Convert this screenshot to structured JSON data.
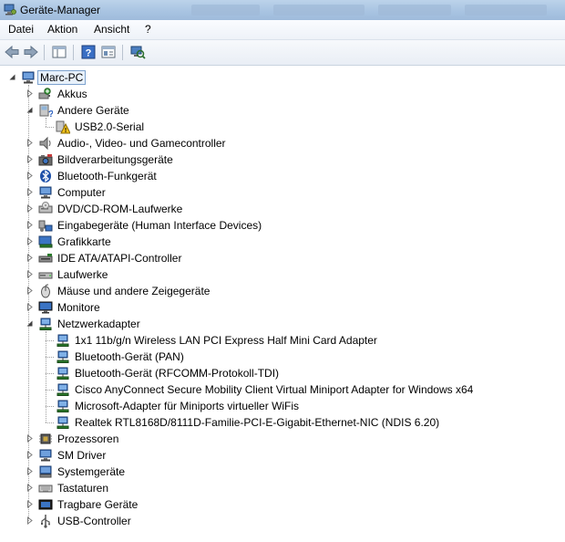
{
  "window": {
    "title": "Geräte-Manager"
  },
  "menu": {
    "items": [
      "Datei",
      "Aktion",
      "Ansicht",
      "?"
    ]
  },
  "toolbar": {
    "buttons": [
      "back-arrow-icon",
      "forward-arrow-icon",
      "console-tree-icon",
      "help-icon",
      "properties-icon",
      "scan-hardware-icon"
    ]
  },
  "tree": {
    "root": "Marc-PC",
    "categories": [
      {
        "label": "Akkus",
        "icon": "battery-icon",
        "expanded": false,
        "children": []
      },
      {
        "label": "Andere Geräte",
        "icon": "unknown-device-icon",
        "expanded": true,
        "children": [
          {
            "label": "USB2.0-Serial",
            "icon": "warning-device-icon"
          }
        ]
      },
      {
        "label": "Audio-, Video- und Gamecontroller",
        "icon": "speaker-icon",
        "expanded": false,
        "children": []
      },
      {
        "label": "Bildverarbeitungsgeräte",
        "icon": "camera-icon",
        "expanded": false,
        "children": []
      },
      {
        "label": "Bluetooth-Funkgerät",
        "icon": "bluetooth-icon",
        "expanded": false,
        "children": []
      },
      {
        "label": "Computer",
        "icon": "computer-icon",
        "expanded": false,
        "children": []
      },
      {
        "label": "DVD/CD-ROM-Laufwerke",
        "icon": "dvd-drive-icon",
        "expanded": false,
        "children": []
      },
      {
        "label": "Eingabegeräte (Human Interface Devices)",
        "icon": "hid-icon",
        "expanded": false,
        "children": []
      },
      {
        "label": "Grafikkarte",
        "icon": "display-adapter-icon",
        "expanded": false,
        "children": []
      },
      {
        "label": "IDE ATA/ATAPI-Controller",
        "icon": "ide-controller-icon",
        "expanded": false,
        "children": []
      },
      {
        "label": "Laufwerke",
        "icon": "disk-drive-icon",
        "expanded": false,
        "children": []
      },
      {
        "label": "Mäuse und andere Zeigegeräte",
        "icon": "mouse-icon",
        "expanded": false,
        "children": []
      },
      {
        "label": "Monitore",
        "icon": "monitor-icon",
        "expanded": false,
        "children": []
      },
      {
        "label": "Netzwerkadapter",
        "icon": "network-adapter-icon",
        "expanded": true,
        "children": [
          {
            "label": "1x1 11b/g/n Wireless LAN PCI Express Half Mini Card Adapter",
            "icon": "network-adapter-icon"
          },
          {
            "label": "Bluetooth-Gerät (PAN)",
            "icon": "network-adapter-icon"
          },
          {
            "label": "Bluetooth-Gerät (RFCOMM-Protokoll-TDI)",
            "icon": "network-adapter-icon"
          },
          {
            "label": "Cisco AnyConnect Secure Mobility Client Virtual Miniport Adapter for Windows x64",
            "icon": "network-adapter-icon"
          },
          {
            "label": "Microsoft-Adapter für Miniports virtueller WiFis",
            "icon": "network-adapter-icon"
          },
          {
            "label": "Realtek RTL8168D/8111D-Familie-PCI-E-Gigabit-Ethernet-NIC (NDIS 6.20)",
            "icon": "network-adapter-icon"
          }
        ]
      },
      {
        "label": "Prozessoren",
        "icon": "processor-icon",
        "expanded": false,
        "children": []
      },
      {
        "label": "SM Driver",
        "icon": "computer-icon",
        "expanded": false,
        "children": []
      },
      {
        "label": "Systemgeräte",
        "icon": "system-device-icon",
        "expanded": false,
        "children": []
      },
      {
        "label": "Tastaturen",
        "icon": "keyboard-icon",
        "expanded": false,
        "children": []
      },
      {
        "label": "Tragbare Geräte",
        "icon": "portable-device-icon",
        "expanded": false,
        "children": []
      },
      {
        "label": "USB-Controller",
        "icon": "usb-icon",
        "expanded": false,
        "children": []
      }
    ]
  }
}
